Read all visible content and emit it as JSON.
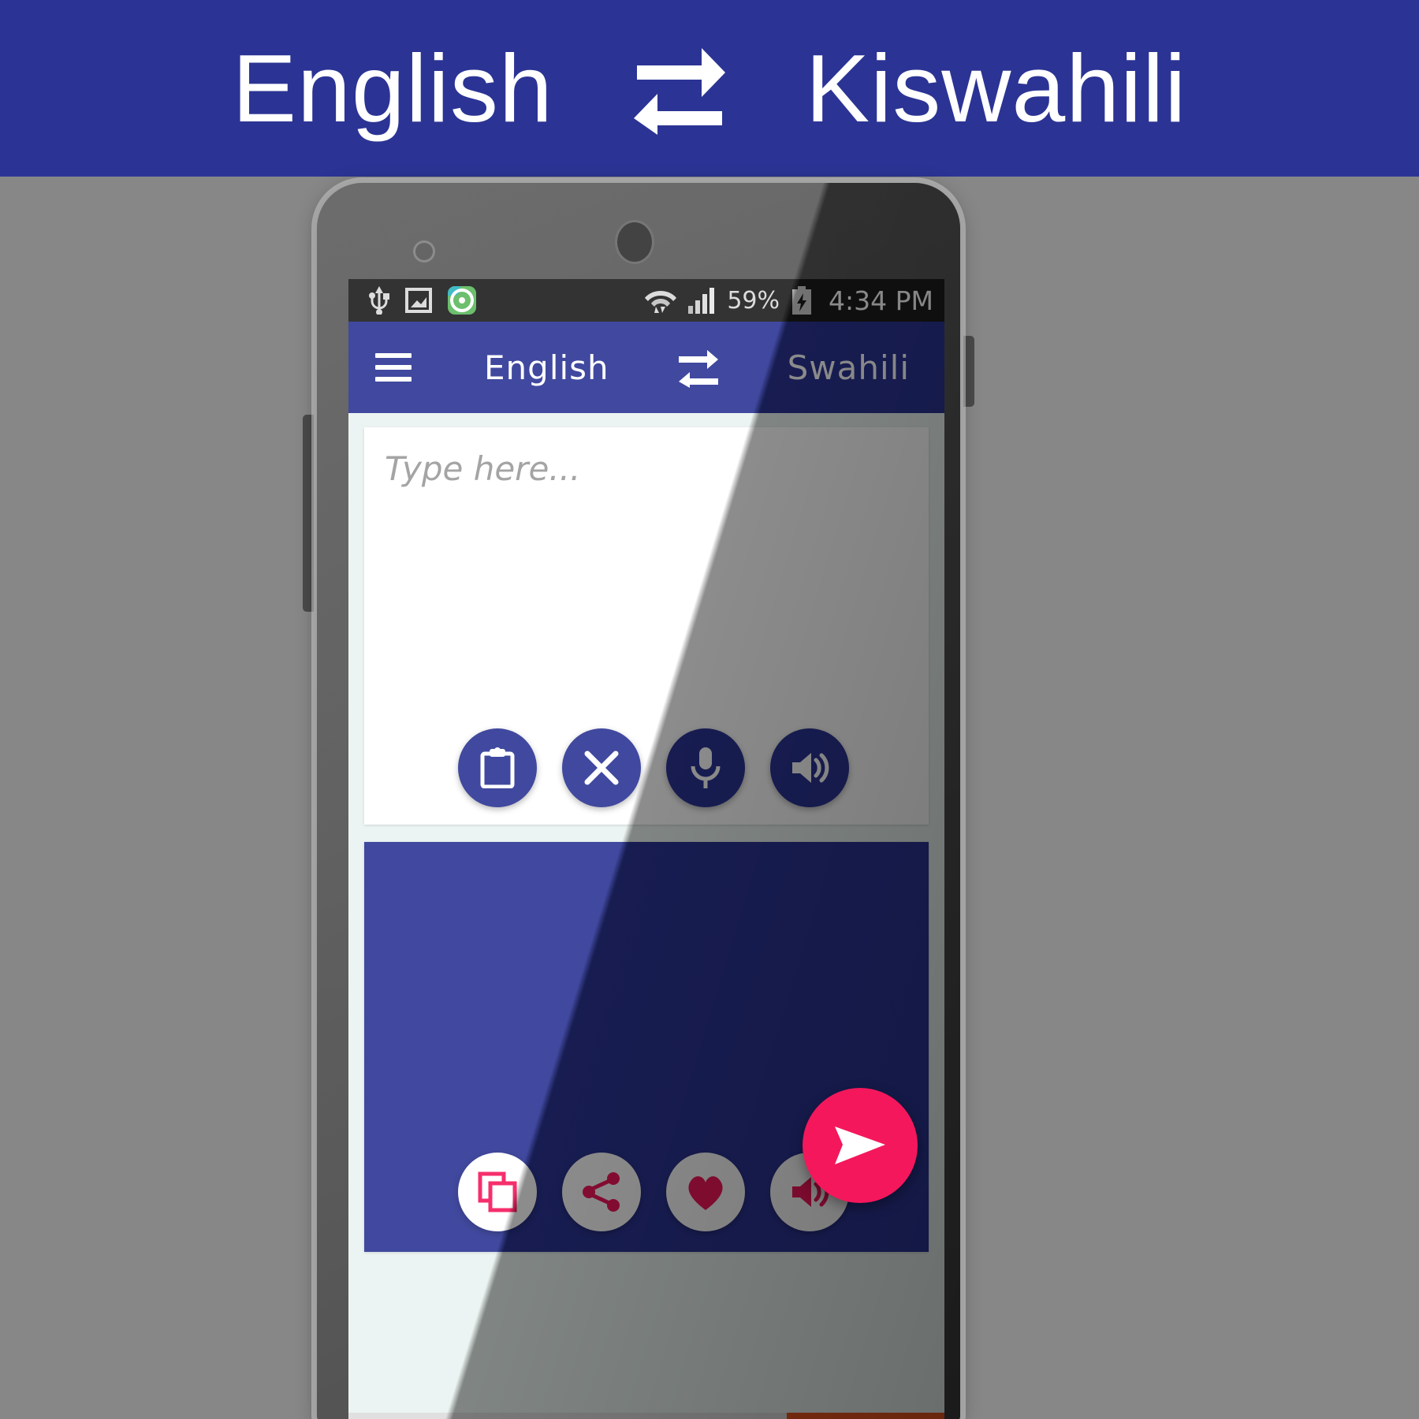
{
  "banner": {
    "source_language": "English",
    "target_language": "Kiswahili",
    "swap_icon": "swap-arrows-icon",
    "background_color": "#2b3494",
    "text_color": "#ffffff"
  },
  "page": {
    "background_color": "#878787"
  },
  "phone": {
    "camera_icon": "front-camera",
    "sensor_icon": "proximity-sensor",
    "volume_button": "volume-rocker",
    "power_button": "power-button"
  },
  "status_bar": {
    "background_color": "#1c1c1c",
    "left_icons": [
      "usb-icon",
      "screenshot-icon",
      "green-app-icon"
    ],
    "wifi_icon": "wifi-icon",
    "signal_icon": "cellular-signal-icon",
    "battery_percent": "59%",
    "battery_icon": "battery-charging-icon",
    "time": "4:34 PM"
  },
  "toolbar": {
    "menu_icon": "hamburger-menu-icon",
    "source_language": "English",
    "swap_icon": "swap-arrows-icon",
    "target_language": "Swahili",
    "background_color": "#2b3494"
  },
  "source_card": {
    "placeholder": "Type here...",
    "background_color": "#ffffff",
    "actions": [
      {
        "name": "paste-button",
        "icon": "clipboard-icon"
      },
      {
        "name": "clear-button",
        "icon": "close-x-icon"
      },
      {
        "name": "voice-input-button",
        "icon": "microphone-icon"
      },
      {
        "name": "speak-source-button",
        "icon": "speaker-icon"
      }
    ]
  },
  "result_card": {
    "text": "",
    "background_color": "#2b3494",
    "actions": [
      {
        "name": "copy-button",
        "icon": "copy-icon"
      },
      {
        "name": "share-button",
        "icon": "share-icon"
      },
      {
        "name": "favorite-button",
        "icon": "heart-icon"
      },
      {
        "name": "speak-result-button",
        "icon": "speaker-icon"
      }
    ],
    "accent_color": "#f4175c"
  },
  "translate_button": {
    "name": "translate-send-button",
    "icon": "send-icon",
    "color": "#f4175c"
  }
}
